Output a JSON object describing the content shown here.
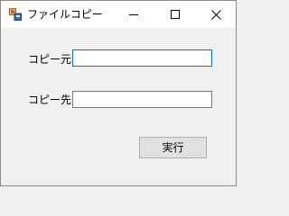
{
  "window": {
    "title": "ファイルコピー",
    "icon": "winforms-app-icon",
    "controls": {
      "minimize_icon": "minimize-icon",
      "maximize_icon": "maximize-icon",
      "close_icon": "close-icon"
    }
  },
  "form": {
    "source_label": "コピー元",
    "source_value": "",
    "destination_label": "コピー先",
    "destination_value": "",
    "run_button": "実行"
  },
  "colors": {
    "background": "#f0f0f0",
    "titlebar": "#ffffff",
    "focus_border": "#0078d7",
    "button_face": "#e1e1e1"
  }
}
